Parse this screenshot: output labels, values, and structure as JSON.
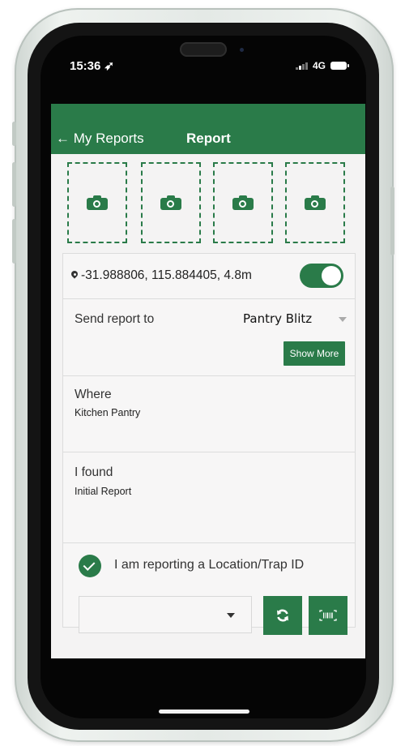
{
  "status_bar": {
    "time": "15:36",
    "network": "4G"
  },
  "header": {
    "back_label": "← My Reports",
    "title": "Report"
  },
  "photos": {
    "slot_count": 4,
    "icon": "camera-icon"
  },
  "location": {
    "coordinates": "-31.988806, 115.884405, 4.8m",
    "icon": "map-pin-icon",
    "toggle_on": true
  },
  "send_report": {
    "label": "Send report to",
    "value": "Pantry Blitz",
    "show_more_label": "Show More"
  },
  "where": {
    "label": "Where",
    "value": "Kitchen Pantry"
  },
  "found": {
    "label": "I found",
    "value": "Initial Report"
  },
  "trap": {
    "checkbox_label": "I am reporting a Location/Trap ID",
    "checked": true,
    "select_value": "",
    "refresh_icon": "refresh-icon",
    "barcode_icon": "barcode-icon"
  },
  "colors": {
    "brand_green": "#2a7b49",
    "background": "#f4f3f3"
  }
}
